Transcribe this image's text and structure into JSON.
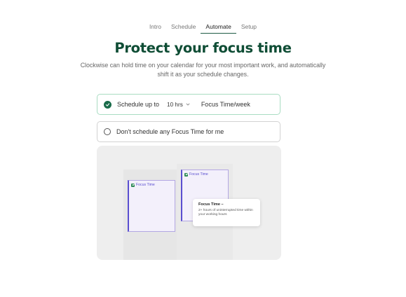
{
  "nav": {
    "tabs": [
      {
        "label": "Intro",
        "active": false
      },
      {
        "label": "Schedule",
        "active": false
      },
      {
        "label": "Automate",
        "active": true
      },
      {
        "label": "Setup",
        "active": false
      }
    ]
  },
  "main": {
    "title": "Protect your focus time",
    "description": "Clockwise can hold time on your calendar for your most important work, and automatically shift it as your schedule changes."
  },
  "options": {
    "schedule": {
      "prefix": "Schedule up to",
      "hours_value": "10 hrs",
      "suffix": "Focus Time/week",
      "selected": true
    },
    "none": {
      "label": "Don't schedule any Focus Time for me",
      "selected": false
    }
  },
  "preview": {
    "block_left_label": "Focus Time",
    "block_right_label": "Focus Time",
    "tooltip_title": "Focus Time –",
    "tooltip_body": "2+ hours of uninterrupted time within your working hours"
  },
  "colors": {
    "accent": "#1a6b4a",
    "title": "#0f4d35",
    "focus_block_border": "#5a4fd0",
    "focus_block_fill": "#f3f0fb"
  },
  "icons": {
    "selected_option": "check-circle-icon",
    "unselected_option": "radio-empty-icon",
    "dropdown": "chevron-down-icon",
    "focus_block": "clockwise-logo-icon"
  }
}
